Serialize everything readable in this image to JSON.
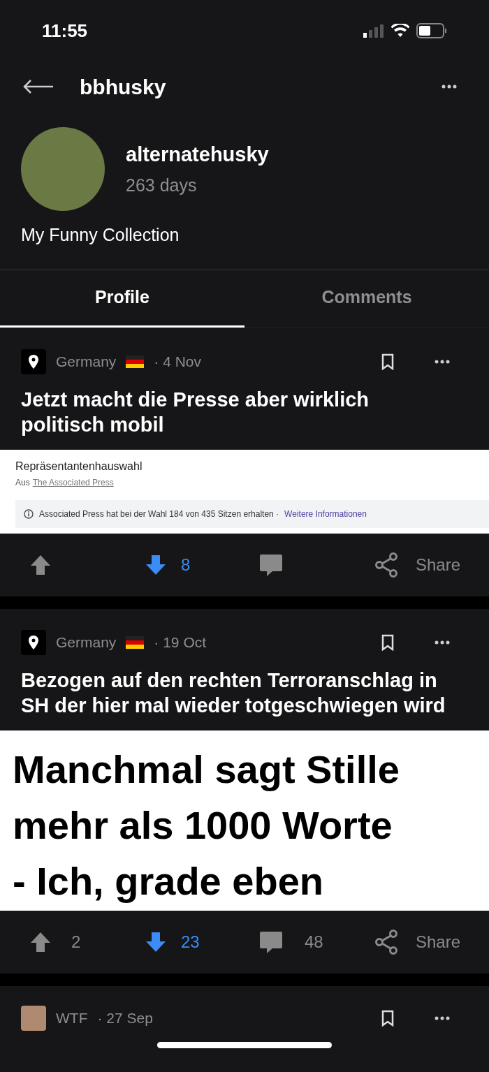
{
  "status_bar": {
    "time": "11:55"
  },
  "header": {
    "title": "bbhusky"
  },
  "profile": {
    "name": "alternatehusky",
    "age": "263 days",
    "bio": "My Funny Collection"
  },
  "tabs": [
    {
      "label": "Profile",
      "selected": true
    },
    {
      "label": "Comments",
      "selected": false
    }
  ],
  "posts": [
    {
      "channel": "Germany",
      "date": "· 4 Nov",
      "title": "Jetzt macht die Presse aber wirklich politisch mobil",
      "image": {
        "kind": "search_result",
        "heading": "Repräsentantenhauswahl",
        "source_prefix": "Aus",
        "source": "The Associated Press",
        "info": "Associated Press hat bei der Wahl 184 von 435 Sitzen erhalten ·",
        "info_link": "Weitere Informationen"
      },
      "upvoted": false,
      "downvoted": true,
      "downvotes": "8",
      "share": "Share"
    },
    {
      "channel": "Germany",
      "date": "· 19 Oct",
      "title": "Bezogen auf den rechten Terroranschlag in SH der hier mal wieder totgeschwiegen wird",
      "image": {
        "kind": "meme_text",
        "lines": [
          "Manchmal sagt Stille",
          "mehr als 1000 Worte",
          "- Ich, grade eben"
        ]
      },
      "upvoted": false,
      "downvoted": true,
      "upvotes": "2",
      "downvotes": "23",
      "comments": "48",
      "share": "Share"
    }
  ],
  "next_post": {
    "channel": "WTF",
    "date": "· 27 Sep"
  }
}
